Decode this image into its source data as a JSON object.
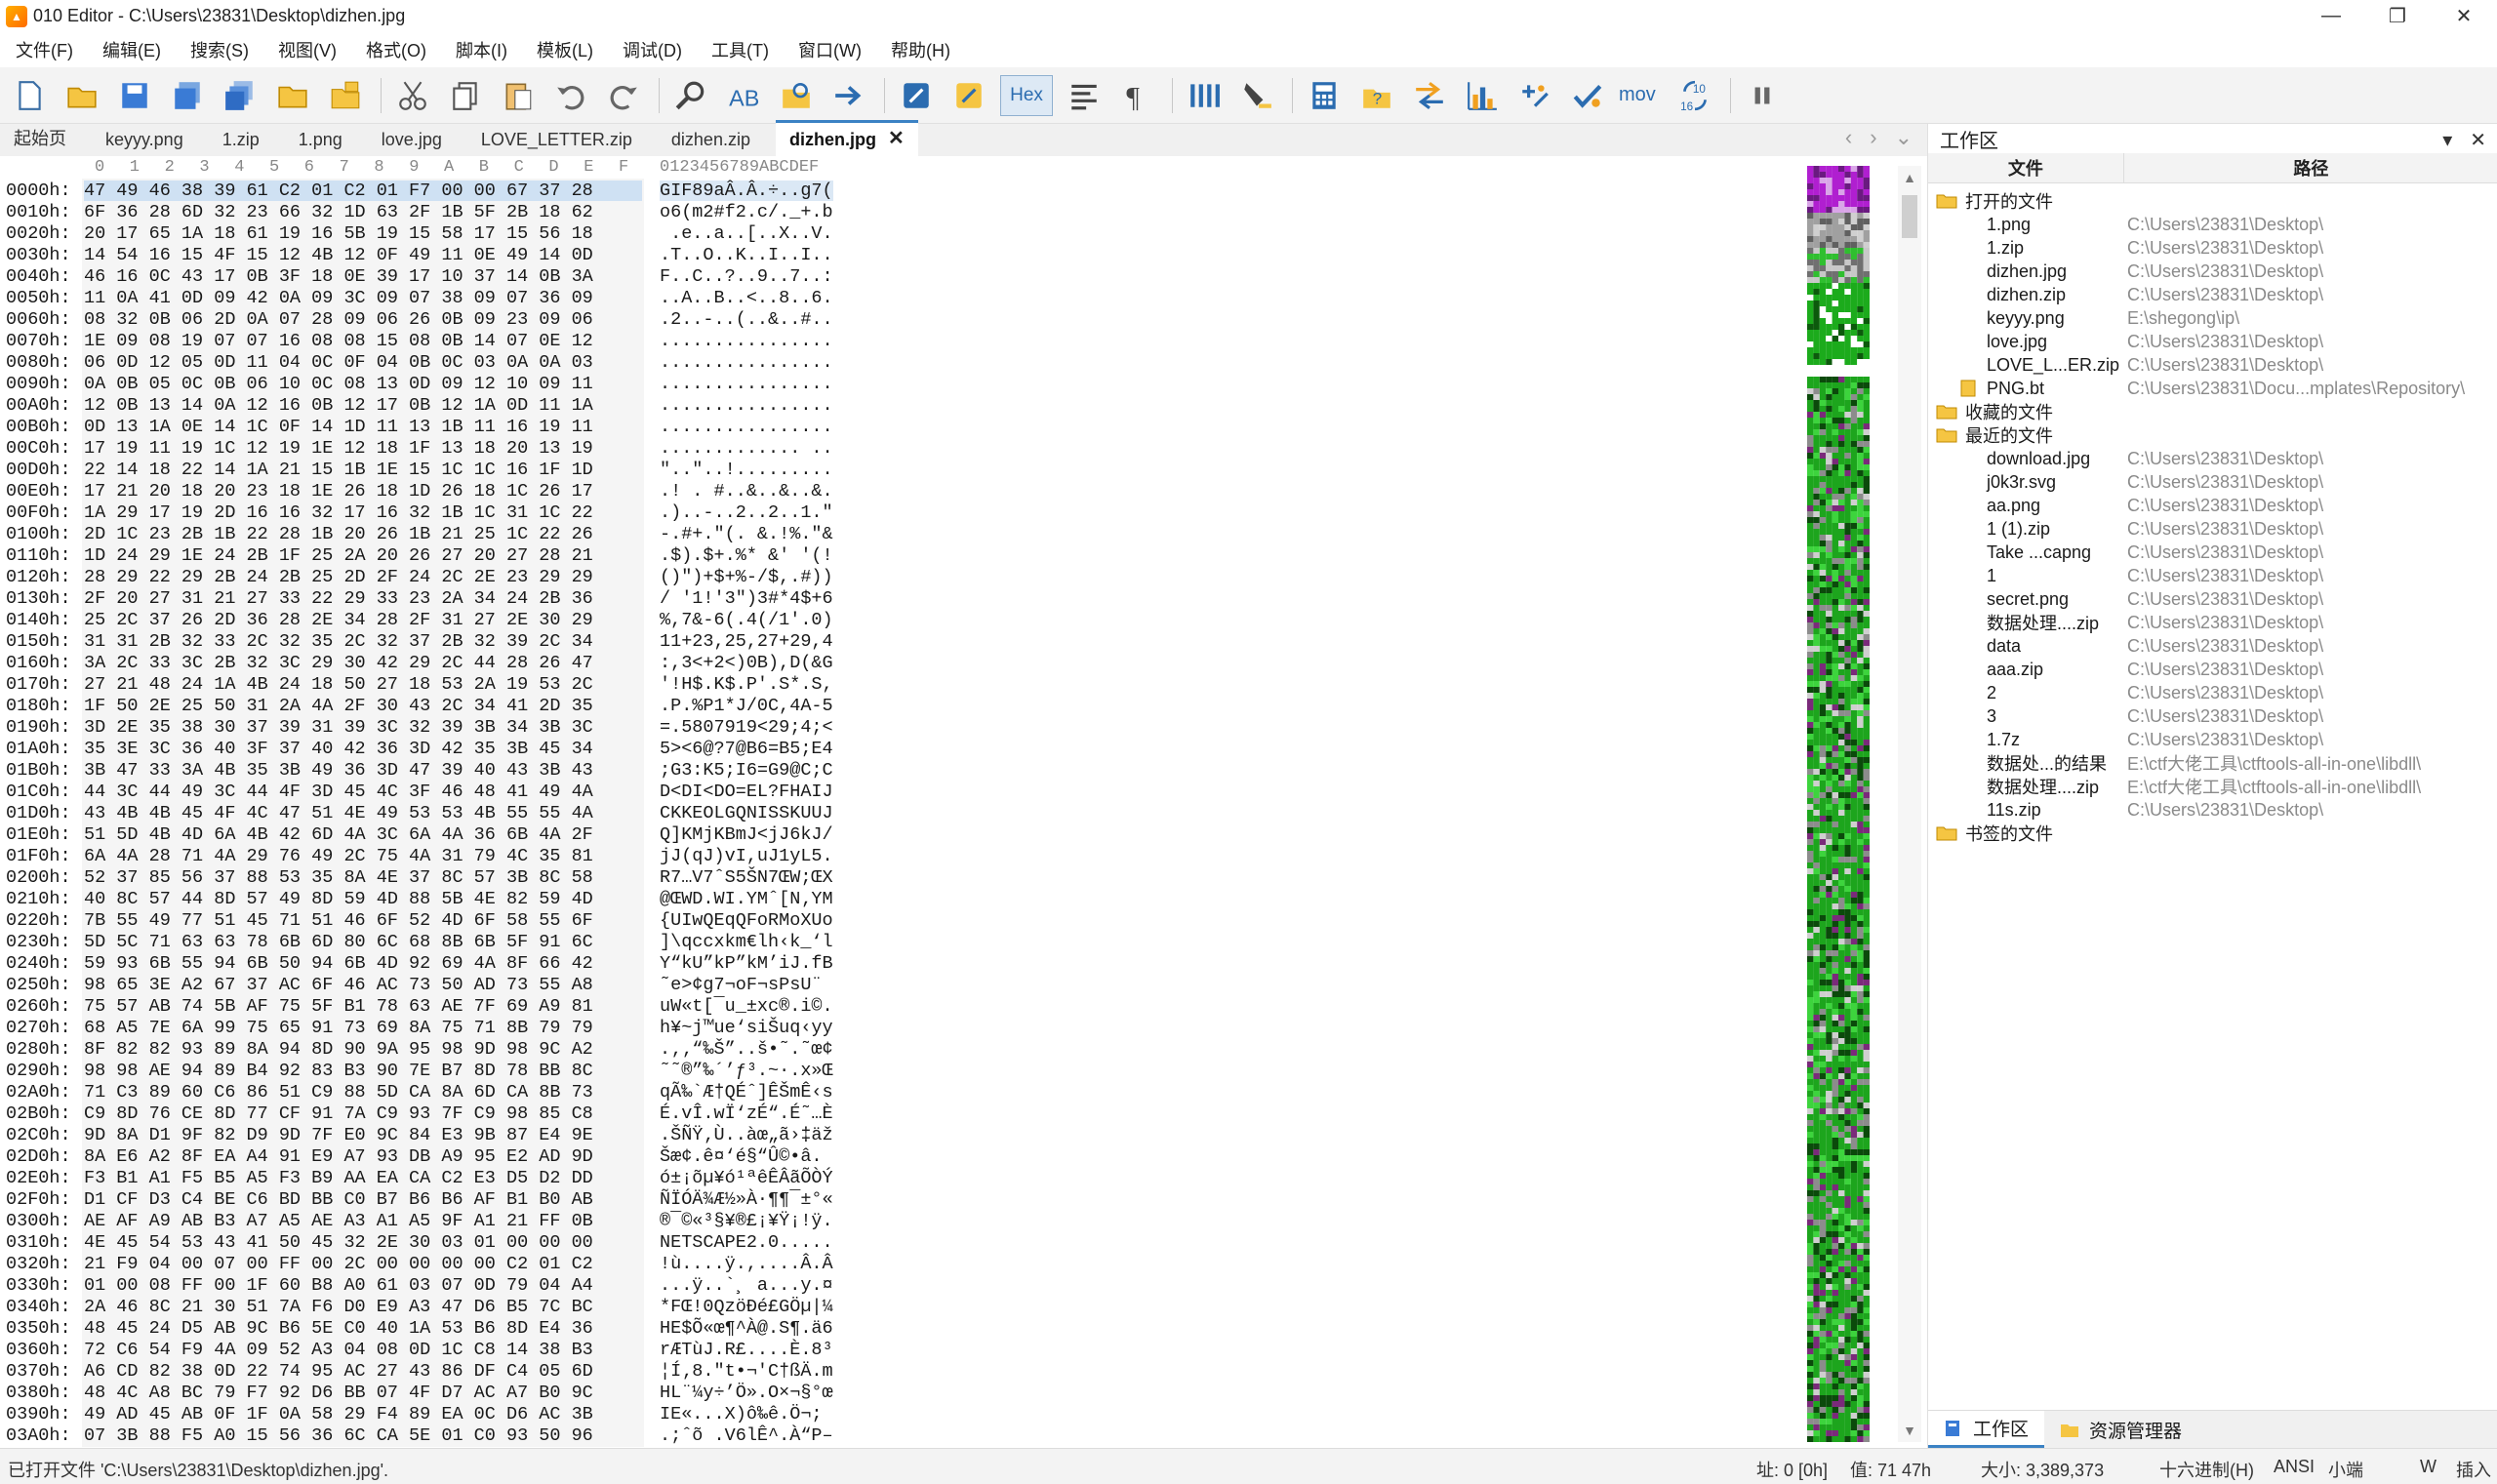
{
  "window": {
    "title": "010 Editor - C:\\Users\\23831\\Desktop\\dizhen.jpg",
    "minimize": "—",
    "maximize": "❐",
    "close": "✕"
  },
  "menu": [
    "文件(F)",
    "编辑(E)",
    "搜索(S)",
    "视图(V)",
    "格式(O)",
    "脚本(I)",
    "模板(L)",
    "调试(D)",
    "工具(T)",
    "窗口(W)",
    "帮助(H)"
  ],
  "toolbar": {
    "hex_label": "Hex",
    "mov_label": "mov",
    "hex_marker": "10\n16"
  },
  "tabs": [
    {
      "label": "起始页"
    },
    {
      "label": "keyyy.png"
    },
    {
      "label": "1.zip"
    },
    {
      "label": "1.png"
    },
    {
      "label": "love.jpg"
    },
    {
      "label": "LOVE_LETTER.zip"
    },
    {
      "label": "dizhen.zip"
    },
    {
      "label": "dizhen.jpg",
      "active": true
    }
  ],
  "editor": {
    "col_header_ascii": "0123456789ABCDEF",
    "columns": [
      "0",
      "1",
      "2",
      "3",
      "4",
      "5",
      "6",
      "7",
      "8",
      "9",
      "A",
      "B",
      "C",
      "D",
      "E",
      "F"
    ],
    "rows": [
      {
        "addr": "0000h:",
        "hex": "47 49 46 38 39 61 C2 01 C2 01 F7 00 00 67 37 28",
        "ascii": "GIF89aÂ.Â.÷..g7("
      },
      {
        "addr": "0010h:",
        "hex": "6F 36 28 6D 32 23 66 32 1D 63 2F 1B 5F 2B 18 62",
        "ascii": "o6(m2#f2.c/._+.b"
      },
      {
        "addr": "0020h:",
        "hex": "20 17 65 1A 18 61 19 16 5B 19 15 58 17 15 56 18",
        "ascii": " .e..a..[..X..V."
      },
      {
        "addr": "0030h:",
        "hex": "14 54 16 15 4F 15 12 4B 12 0F 49 11 0E 49 14 0D",
        "ascii": ".T..O..K..I..I.."
      },
      {
        "addr": "0040h:",
        "hex": "46 16 0C 43 17 0B 3F 18 0E 39 17 10 37 14 0B 3A",
        "ascii": "F..C..?..9..7..:"
      },
      {
        "addr": "0050h:",
        "hex": "11 0A 41 0D 09 42 0A 09 3C 09 07 38 09 07 36 09",
        "ascii": "..A..B..<..8..6."
      },
      {
        "addr": "0060h:",
        "hex": "08 32 0B 06 2D 0A 07 28 09 06 26 0B 09 23 09 06",
        "ascii": ".2..-..(..&..#.."
      },
      {
        "addr": "0070h:",
        "hex": "1E 09 08 19 07 07 16 08 08 15 08 0B 14 07 0E 12",
        "ascii": "................"
      },
      {
        "addr": "0080h:",
        "hex": "06 0D 12 05 0D 11 04 0C 0F 04 0B 0C 03 0A 0A 03",
        "ascii": "................"
      },
      {
        "addr": "0090h:",
        "hex": "0A 0B 05 0C 0B 06 10 0C 08 13 0D 09 12 10 09 11",
        "ascii": "................"
      },
      {
        "addr": "00A0h:",
        "hex": "12 0B 13 14 0A 12 16 0B 12 17 0B 12 1A 0D 11 1A",
        "ascii": "................"
      },
      {
        "addr": "00B0h:",
        "hex": "0D 13 1A 0E 14 1C 0F 14 1D 11 13 1B 11 16 19 11",
        "ascii": "................"
      },
      {
        "addr": "00C0h:",
        "hex": "17 19 11 19 1C 12 19 1E 12 18 1F 13 18 20 13 19",
        "ascii": "............. .."
      },
      {
        "addr": "00D0h:",
        "hex": "22 14 18 22 14 1A 21 15 1B 1E 15 1C 1C 16 1F 1D",
        "ascii": "\"..\"..!........."
      },
      {
        "addr": "00E0h:",
        "hex": "17 21 20 18 20 23 18 1E 26 18 1D 26 18 1C 26 17",
        "ascii": ".! . #..&..&..&."
      },
      {
        "addr": "00F0h:",
        "hex": "1A 29 17 19 2D 16 16 32 17 16 32 1B 1C 31 1C 22",
        "ascii": ".)..-..2..2..1.\""
      },
      {
        "addr": "0100h:",
        "hex": "2D 1C 23 2B 1B 22 28 1B 20 26 1B 21 25 1C 22 26",
        "ascii": "-.#+.\"(. &.!%.\"&"
      },
      {
        "addr": "0110h:",
        "hex": "1D 24 29 1E 24 2B 1F 25 2A 20 26 27 20 27 28 21",
        "ascii": ".$).$+.%* &' '(!"
      },
      {
        "addr": "0120h:",
        "hex": "28 29 22 29 2B 24 2B 25 2D 2F 24 2C 2E 23 29 29",
        "ascii": "()\")+$+%-/$,.#))"
      },
      {
        "addr": "0130h:",
        "hex": "2F 20 27 31 21 27 33 22 29 33 23 2A 34 24 2B 36",
        "ascii": "/ '1!'3\")3#*4$+6"
      },
      {
        "addr": "0140h:",
        "hex": "25 2C 37 26 2D 36 28 2E 34 28 2F 31 27 2E 30 29",
        "ascii": "%,7&-6(.4(/1'.0)"
      },
      {
        "addr": "0150h:",
        "hex": "31 31 2B 32 33 2C 32 35 2C 32 37 2B 32 39 2C 34",
        "ascii": "11+23,25,27+29,4"
      },
      {
        "addr": "0160h:",
        "hex": "3A 2C 33 3C 2B 32 3C 29 30 42 29 2C 44 28 26 47",
        "ascii": ":,3<+2<)0B),D(&G"
      },
      {
        "addr": "0170h:",
        "hex": "27 21 48 24 1A 4B 24 18 50 27 18 53 2A 19 53 2C",
        "ascii": "'!H$.K$.P'.S*.S,"
      },
      {
        "addr": "0180h:",
        "hex": "1F 50 2E 25 50 31 2A 4A 2F 30 43 2C 34 41 2D 35",
        "ascii": ".P.%P1*J/0C,4A-5"
      },
      {
        "addr": "0190h:",
        "hex": "3D 2E 35 38 30 37 39 31 39 3C 32 39 3B 34 3B 3C",
        "ascii": "=.5807919<29;4;<"
      },
      {
        "addr": "01A0h:",
        "hex": "35 3E 3C 36 40 3F 37 40 42 36 3D 42 35 3B 45 34",
        "ascii": "5><6@?7@B6=B5;E4"
      },
      {
        "addr": "01B0h:",
        "hex": "3B 47 33 3A 4B 35 3B 49 36 3D 47 39 40 43 3B 43",
        "ascii": ";G3:K5;I6=G9@C;C"
      },
      {
        "addr": "01C0h:",
        "hex": "44 3C 44 49 3C 44 4F 3D 45 4C 3F 46 48 41 49 4A",
        "ascii": "D<DI<DO=EL?FHAIJ"
      },
      {
        "addr": "01D0h:",
        "hex": "43 4B 4B 45 4F 4C 47 51 4E 49 53 53 4B 55 55 4A",
        "ascii": "CKKEOLGQNISSKUUJ"
      },
      {
        "addr": "01E0h:",
        "hex": "51 5D 4B 4D 6A 4B 42 6D 4A 3C 6A 4A 36 6B 4A 2F",
        "ascii": "Q]KMjKBmJ<jJ6kJ/"
      },
      {
        "addr": "01F0h:",
        "hex": "6A 4A 28 71 4A 29 76 49 2C 75 4A 31 79 4C 35 81",
        "ascii": "jJ(qJ)vI,uJ1yL5."
      },
      {
        "addr": "0200h:",
        "hex": "52 37 85 56 37 88 53 35 8A 4E 37 8C 57 3B 8C 58",
        "ascii": "R7…V7ˆS5ŠN7ŒW;ŒX"
      },
      {
        "addr": "0210h:",
        "hex": "40 8C 57 44 8D 57 49 8D 59 4D 88 5B 4E 82 59 4D",
        "ascii": "@ŒWD.WI.YMˆ[N‚YM"
      },
      {
        "addr": "0220h:",
        "hex": "7B 55 49 77 51 45 71 51 46 6F 52 4D 6F 58 55 6F",
        "ascii": "{UIwQEqQFoRMoXUo"
      },
      {
        "addr": "0230h:",
        "hex": "5D 5C 71 63 63 78 6B 6D 80 6C 68 8B 6B 5F 91 6C",
        "ascii": "]\\qccxkm€lh‹k_‘l"
      },
      {
        "addr": "0240h:",
        "hex": "59 93 6B 55 94 6B 50 94 6B 4D 92 69 4A 8F 66 42",
        "ascii": "Y“kU”kP”kM’iJ.fB"
      },
      {
        "addr": "0250h:",
        "hex": "98 65 3E A2 67 37 AC 6F 46 AC 73 50 AD 73 55 A8",
        "ascii": "˜e>¢g7¬oF¬sP­sU¨"
      },
      {
        "addr": "0260h:",
        "hex": "75 57 AB 74 5B AF 75 5F B1 78 63 AE 7F 69 A9 81",
        "ascii": "uW«t[¯u_±xc®.i©."
      },
      {
        "addr": "0270h:",
        "hex": "68 A5 7E 6A 99 75 65 91 73 69 8A 75 71 8B 79 79",
        "ascii": "h¥~j™ue‘siŠuq‹yy"
      },
      {
        "addr": "0280h:",
        "hex": "8F 82 82 93 89 8A 94 8D 90 9A 95 98 9D 98 9C A2",
        "ascii": ".‚‚“‰Š”..š•˜.˜œ¢"
      },
      {
        "addr": "0290h:",
        "hex": "98 98 AE 94 89 B4 92 83 B3 90 7E B7 8D 78 BB 8C",
        "ascii": "˜˜®”‰´’ƒ³.~·.x»Œ"
      },
      {
        "addr": "02A0h:",
        "hex": "71 C3 89 60 C6 86 51 C9 88 5D CA 8A 6D CA 8B 73",
        "ascii": "qÃ‰`Æ†QÉˆ]ÊŠmÊ‹s"
      },
      {
        "addr": "02B0h:",
        "hex": "C9 8D 76 CE 8D 77 CF 91 7A C9 93 7F C9 98 85 C8",
        "ascii": "É.vÎ.wÏ‘zÉ“.É˜…È"
      },
      {
        "addr": "02C0h:",
        "hex": "9D 8A D1 9F 82 D9 9D 7F E0 9C 84 E3 9B 87 E4 9E",
        "ascii": ".ŠÑŸ‚Ù..àœ„ã›‡äž"
      },
      {
        "addr": "02D0h:",
        "hex": "8A E6 A2 8F EA A4 91 E9 A7 93 DB A9 95 E2 AD 9D",
        "ascii": "Šæ¢.ê¤‘é§“Û©•â­."
      },
      {
        "addr": "02E0h:",
        "hex": "F3 B1 A1 F5 B5 A5 F3 B9 AA EA CA C2 E3 D5 D2 DD",
        "ascii": "ó±¡õµ¥ó¹ªêÊÂãÕÒÝ"
      },
      {
        "addr": "02F0h:",
        "hex": "D1 CF D3 C4 BE C6 BD BB C0 B7 B6 B6 AF B1 B0 AB",
        "ascii": "ÑÏÓÄ¾Æ½»À·¶¶¯±°«"
      },
      {
        "addr": "0300h:",
        "hex": "AE AF A9 AB B3 A7 A5 AE A3 A1 A5 9F A1 21 FF 0B",
        "ascii": "®¯©«³§¥®£¡¥Ÿ¡!ÿ."
      },
      {
        "addr": "0310h:",
        "hex": "4E 45 54 53 43 41 50 45 32 2E 30 03 01 00 00 00",
        "ascii": "NETSCAPE2.0....."
      },
      {
        "addr": "0320h:",
        "hex": "21 F9 04 00 07 00 FF 00 2C 00 00 00 00 C2 01 C2",
        "ascii": "!ù....ÿ.,....Â.Â"
      },
      {
        "addr": "0330h:",
        "hex": "01 00 08 FF 00 1F 60 B8 A0 61 03 07 0D 79 04 A4",
        "ascii": "...ÿ..`¸ a...y.¤"
      },
      {
        "addr": "0340h:",
        "hex": "2A 46 8C 21 30 51 7A F6 D0 E9 A3 47 D6 B5 7C BC",
        "ascii": "*FŒ!0QzöÐé£GÖµ|¼"
      },
      {
        "addr": "0350h:",
        "hex": "48 45 24 D5 AB 9C B6 5E C0 40 1A 53 B6 8D E4 36",
        "ascii": "HE$Õ«œ¶^À@.S¶.ä6"
      },
      {
        "addr": "0360h:",
        "hex": "72 C6 54 F9 4A 09 52 A3 04 08 0D 1C C8 14 38 B3",
        "ascii": "rÆTùJ.R£....È.8³"
      },
      {
        "addr": "0370h:",
        "hex": "A6 CD 82 38 0D 22 74 95 AC 27 43 86 DF C4 05 6D",
        "ascii": "¦Í‚8.\"t•¬'C†ßÄ.m"
      },
      {
        "addr": "0380h:",
        "hex": "48 4C A8 BC 79 F7 92 D6 BB 07 4F D7 AC A7 B0 9C",
        "ascii": "HL¨¼y÷’Ö».O×¬§°œ"
      },
      {
        "addr": "0390h:",
        "hex": "49 AD 45 AB 0F 1F 0A 58 29 F4 89 EA 0C D6 AC 3B",
        "ascii": "I­E«...X)ô‰ê.Ö¬;"
      },
      {
        "addr": "03A0h:",
        "hex": "07 3B 88 F5 A0 15 56 36 6C CA 5E 01 C0 93 50 96",
        "ascii": ".;ˆõ .V6lÊ^.À“P–"
      }
    ]
  },
  "panel": {
    "title": "工作区",
    "col_file": "文件",
    "col_path": "路径",
    "groups": [
      {
        "label": "打开的文件",
        "items": [
          {
            "name": "1.png",
            "path": "C:\\Users\\23831\\Desktop\\"
          },
          {
            "name": "1.zip",
            "path": "C:\\Users\\23831\\Desktop\\"
          },
          {
            "name": "dizhen.jpg",
            "path": "C:\\Users\\23831\\Desktop\\"
          },
          {
            "name": "dizhen.zip",
            "path": "C:\\Users\\23831\\Desktop\\"
          },
          {
            "name": "keyyy.png",
            "path": "E:\\shegong\\ip\\"
          },
          {
            "name": "love.jpg",
            "path": "C:\\Users\\23831\\Desktop\\"
          },
          {
            "name": "LOVE_L...ER.zip",
            "path": "C:\\Users\\23831\\Desktop\\"
          },
          {
            "name": "PNG.bt",
            "path": "C:\\Users\\23831\\Docu...mplates\\Repository\\"
          }
        ]
      },
      {
        "label": "收藏的文件",
        "items": []
      },
      {
        "label": "最近的文件",
        "items": [
          {
            "name": "download.jpg",
            "path": "C:\\Users\\23831\\Desktop\\"
          },
          {
            "name": "j0k3r.svg",
            "path": "C:\\Users\\23831\\Desktop\\"
          },
          {
            "name": "aa.png",
            "path": "C:\\Users\\23831\\Desktop\\"
          },
          {
            "name": "1 (1).zip",
            "path": "C:\\Users\\23831\\Desktop\\"
          },
          {
            "name": "Take ...capng",
            "path": "C:\\Users\\23831\\Desktop\\"
          },
          {
            "name": "1",
            "path": "C:\\Users\\23831\\Desktop\\"
          },
          {
            "name": "secret.png",
            "path": "C:\\Users\\23831\\Desktop\\"
          },
          {
            "name": "数据处理....zip",
            "path": "C:\\Users\\23831\\Desktop\\"
          },
          {
            "name": "data",
            "path": "C:\\Users\\23831\\Desktop\\"
          },
          {
            "name": "aaa.zip",
            "path": "C:\\Users\\23831\\Desktop\\"
          },
          {
            "name": "2",
            "path": "C:\\Users\\23831\\Desktop\\"
          },
          {
            "name": "3",
            "path": "C:\\Users\\23831\\Desktop\\"
          },
          {
            "name": "1.7z",
            "path": "C:\\Users\\23831\\Desktop\\"
          },
          {
            "name": "数据处...的结果",
            "path": "E:\\ctf大佬工具\\ctftools-all-in-one\\libdll\\"
          },
          {
            "name": "数据处理....zip",
            "path": "E:\\ctf大佬工具\\ctftools-all-in-one\\libdll\\"
          },
          {
            "name": "11s.zip",
            "path": "C:\\Users\\23831\\Desktop\\"
          }
        ]
      },
      {
        "label": "书签的文件",
        "items": []
      }
    ],
    "tab_workspace": "工作区",
    "tab_explorer": "资源管理器"
  },
  "status": {
    "left": "已打开文件 'C:\\Users\\23831\\Desktop\\dizhen.jpg'.",
    "addr": "址: 0 [0h]",
    "value": "值: 71 47h",
    "size": "大小: 3,389,373",
    "mode": "十六进制(H)",
    "encoding": "ANSI",
    "endian": "小端",
    "w": "W",
    "insert": "插入"
  }
}
